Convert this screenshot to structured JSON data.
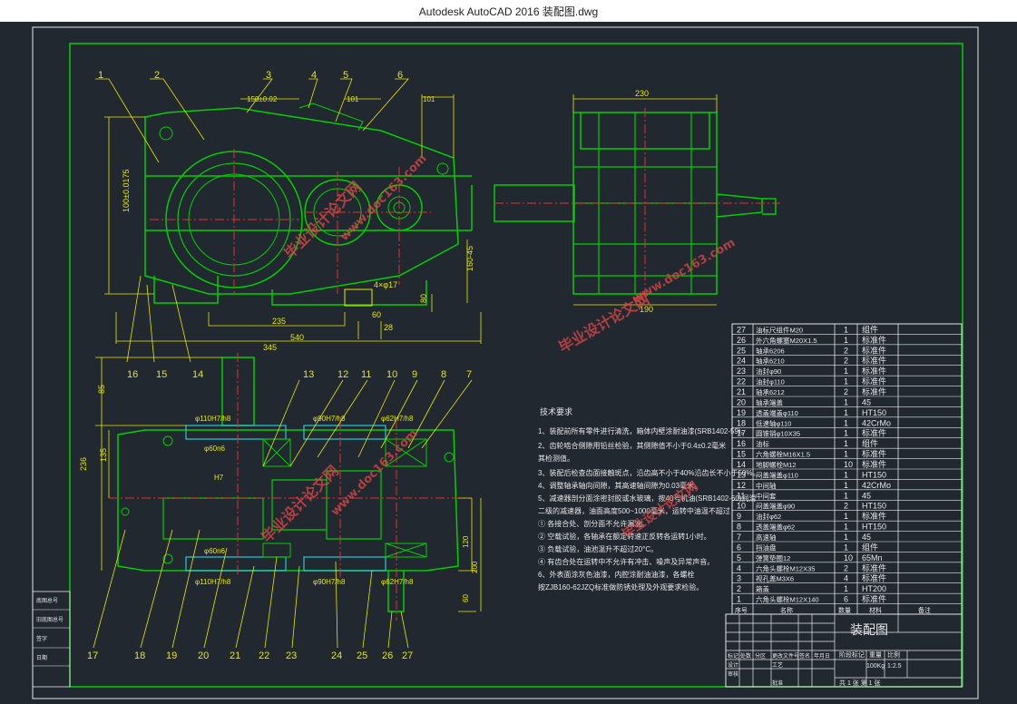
{
  "window": {
    "title": "Autodesk AutoCAD 2016     装配图.dwg"
  },
  "colors": {
    "bg": "#212830",
    "yellow": "#e8e800",
    "green": "#00d000",
    "white": "#e8e8e8",
    "red": "#e03030",
    "cyan": "#28c8d8"
  },
  "top_view": {
    "callouts": [
      "1",
      "2",
      "3",
      "4",
      "5",
      "6"
    ],
    "dims": [
      "150±0.02",
      "100±0.0175",
      "101",
      "313",
      "345",
      "540",
      "235",
      "60",
      "28",
      "4×φ17",
      "80",
      "160-45",
      "20"
    ]
  },
  "side_view": {
    "dims": [
      "230",
      "190"
    ]
  },
  "plan_view": {
    "callouts_top": [
      "16",
      "15",
      "14",
      "13",
      "12",
      "11",
      "10",
      "9",
      "8",
      "7"
    ],
    "callouts_bottom": [
      "17",
      "18",
      "19",
      "20",
      "21",
      "22",
      "23",
      "24",
      "25",
      "26",
      "27"
    ],
    "dims": [
      "85",
      "135",
      "236",
      "φ110H7/h8",
      "φ60n6",
      "H7",
      "φ90H7/h8",
      "φ62H7/h8",
      "φ60n6",
      "φ110H7/h8",
      "φ90H7/h8",
      "φ62H7/h8",
      "120",
      "200",
      "60"
    ]
  },
  "notes": {
    "heading": "技术要求",
    "lines": [
      "1、装配前所有零件进行清洗，箱体内壁涂耐油漆(SRB1402-59)。",
      "2、齿轮啮合侧隙用铅丝检验，其侧隙值不小于0.4±0.2毫米",
      "   其检测值。",
      "3、装配后检查齿面接触斑点，沿齿高不小于40%沿齿长不小于50%。",
      "4、调整轴承轴向间隙，其高速轴间隙为0.03毫米。",
      "5、减速器剖分面涂密封胶或水玻璃，按40号机油(SRB1402-60)润滑",
      "   二级的减速器，油面高度500~1000毫米，运转中油温不超过",
      "① 各接合处、剖分面不允许漏油。",
      "② 空载试验，各轴承在额定转速正反转各运转1小时。",
      "③ 负载试验，油池温升不超过20°C。",
      "④ 有齿合处在运转中不允许有冲击、噪声及异常声音。",
      "6、外表面涂灰色油漆，内腔涂耐油油漆，各螺栓",
      "   按ZJB160-62JZQ标准做防锈处理及外观要求检验。"
    ]
  },
  "bom": {
    "rows": [
      {
        "no": "27",
        "name": "油标尺组件M20",
        "qty": "1",
        "mat": "组件"
      },
      {
        "no": "26",
        "name": "外六角螺塞M20X1.5",
        "qty": "1",
        "mat": "标准件"
      },
      {
        "no": "25",
        "name": "轴承6206",
        "qty": "2",
        "mat": "标准件"
      },
      {
        "no": "24",
        "name": "轴承6210",
        "qty": "2",
        "mat": "标准件"
      },
      {
        "no": "23",
        "name": "油封φ90",
        "qty": "1",
        "mat": "标准件"
      },
      {
        "no": "22",
        "name": "油封φ110",
        "qty": "1",
        "mat": "标准件"
      },
      {
        "no": "21",
        "name": "轴承6212",
        "qty": "2",
        "mat": "标准件"
      },
      {
        "no": "20",
        "name": "轴承端盖",
        "qty": "1",
        "mat": "45"
      },
      {
        "no": "19",
        "name": "透盖端盖φ110",
        "qty": "1",
        "mat": "HT150"
      },
      {
        "no": "18",
        "name": "低速轴φ110",
        "qty": "1",
        "mat": "42CrMo"
      },
      {
        "no": "17",
        "name": "圆锥销φ10X35",
        "qty": "1",
        "mat": "标准件"
      },
      {
        "no": "16",
        "name": "油标",
        "qty": "1",
        "mat": "组件"
      },
      {
        "no": "15",
        "name": "六角螺栓M16X1.5",
        "qty": "1",
        "mat": "标准件"
      },
      {
        "no": "14",
        "name": "地脚螺栓M12",
        "qty": "10",
        "mat": "标准件"
      },
      {
        "no": "13",
        "name": "闷盖端盖φ110",
        "qty": "1",
        "mat": "HT150"
      },
      {
        "no": "12",
        "name": "中间轴",
        "qty": "1",
        "mat": "42CrMo"
      },
      {
        "no": "11",
        "name": "中间套",
        "qty": "1",
        "mat": "45"
      },
      {
        "no": "10",
        "name": "闷盖端盖φ90",
        "qty": "2",
        "mat": "HT150"
      },
      {
        "no": "9",
        "name": "油封φ62",
        "qty": "1",
        "mat": "标准件"
      },
      {
        "no": "8",
        "name": "透盖端盖φ62",
        "qty": "1",
        "mat": "HT150"
      },
      {
        "no": "7",
        "name": "高速轴",
        "qty": "1",
        "mat": "45"
      },
      {
        "no": "6",
        "name": "挡油盘",
        "qty": "1",
        "mat": "组件"
      },
      {
        "no": "5",
        "name": "弹簧垫圈12",
        "qty": "10",
        "mat": "65Mn"
      },
      {
        "no": "4",
        "name": "六角头螺栓M12X35",
        "qty": "2",
        "mat": "标准件"
      },
      {
        "no": "3",
        "name": "视孔盖M3X6",
        "qty": "4",
        "mat": "标准件"
      },
      {
        "no": "2",
        "name": "箱盖",
        "qty": "1",
        "mat": "HT200"
      },
      {
        "no": "1",
        "name": "六角头螺栓M12X140",
        "qty": "6",
        "mat": "标准件"
      }
    ],
    "header": {
      "no": "序号",
      "name": "名称",
      "qty": "数量",
      "mat": "材料",
      "note": "备注"
    }
  },
  "titleblock": {
    "drawing_name": "装配图",
    "scale_label": "比例",
    "scale": "1:2.5",
    "weight_label": "重量",
    "weight": "100Kg",
    "sheet": "共 1 张  第 1 张",
    "row_labels": [
      "标记",
      "处数",
      "分区",
      "更改文件号",
      "签名",
      "年月日"
    ],
    "role_labels": [
      "设计",
      "审核",
      "工艺",
      "批准"
    ],
    "stage_label": "阶段标记"
  },
  "side_labels": [
    "底图总号",
    "旧底图总号",
    "签字",
    "日期"
  ],
  "watermarks": [
    "毕业设计论文网",
    "www.doc163.com",
    "毕业设计论文网",
    "www.doc163.com",
    "毕业设计论文网",
    "www.doc163.com",
    "毕业设计论文网"
  ]
}
